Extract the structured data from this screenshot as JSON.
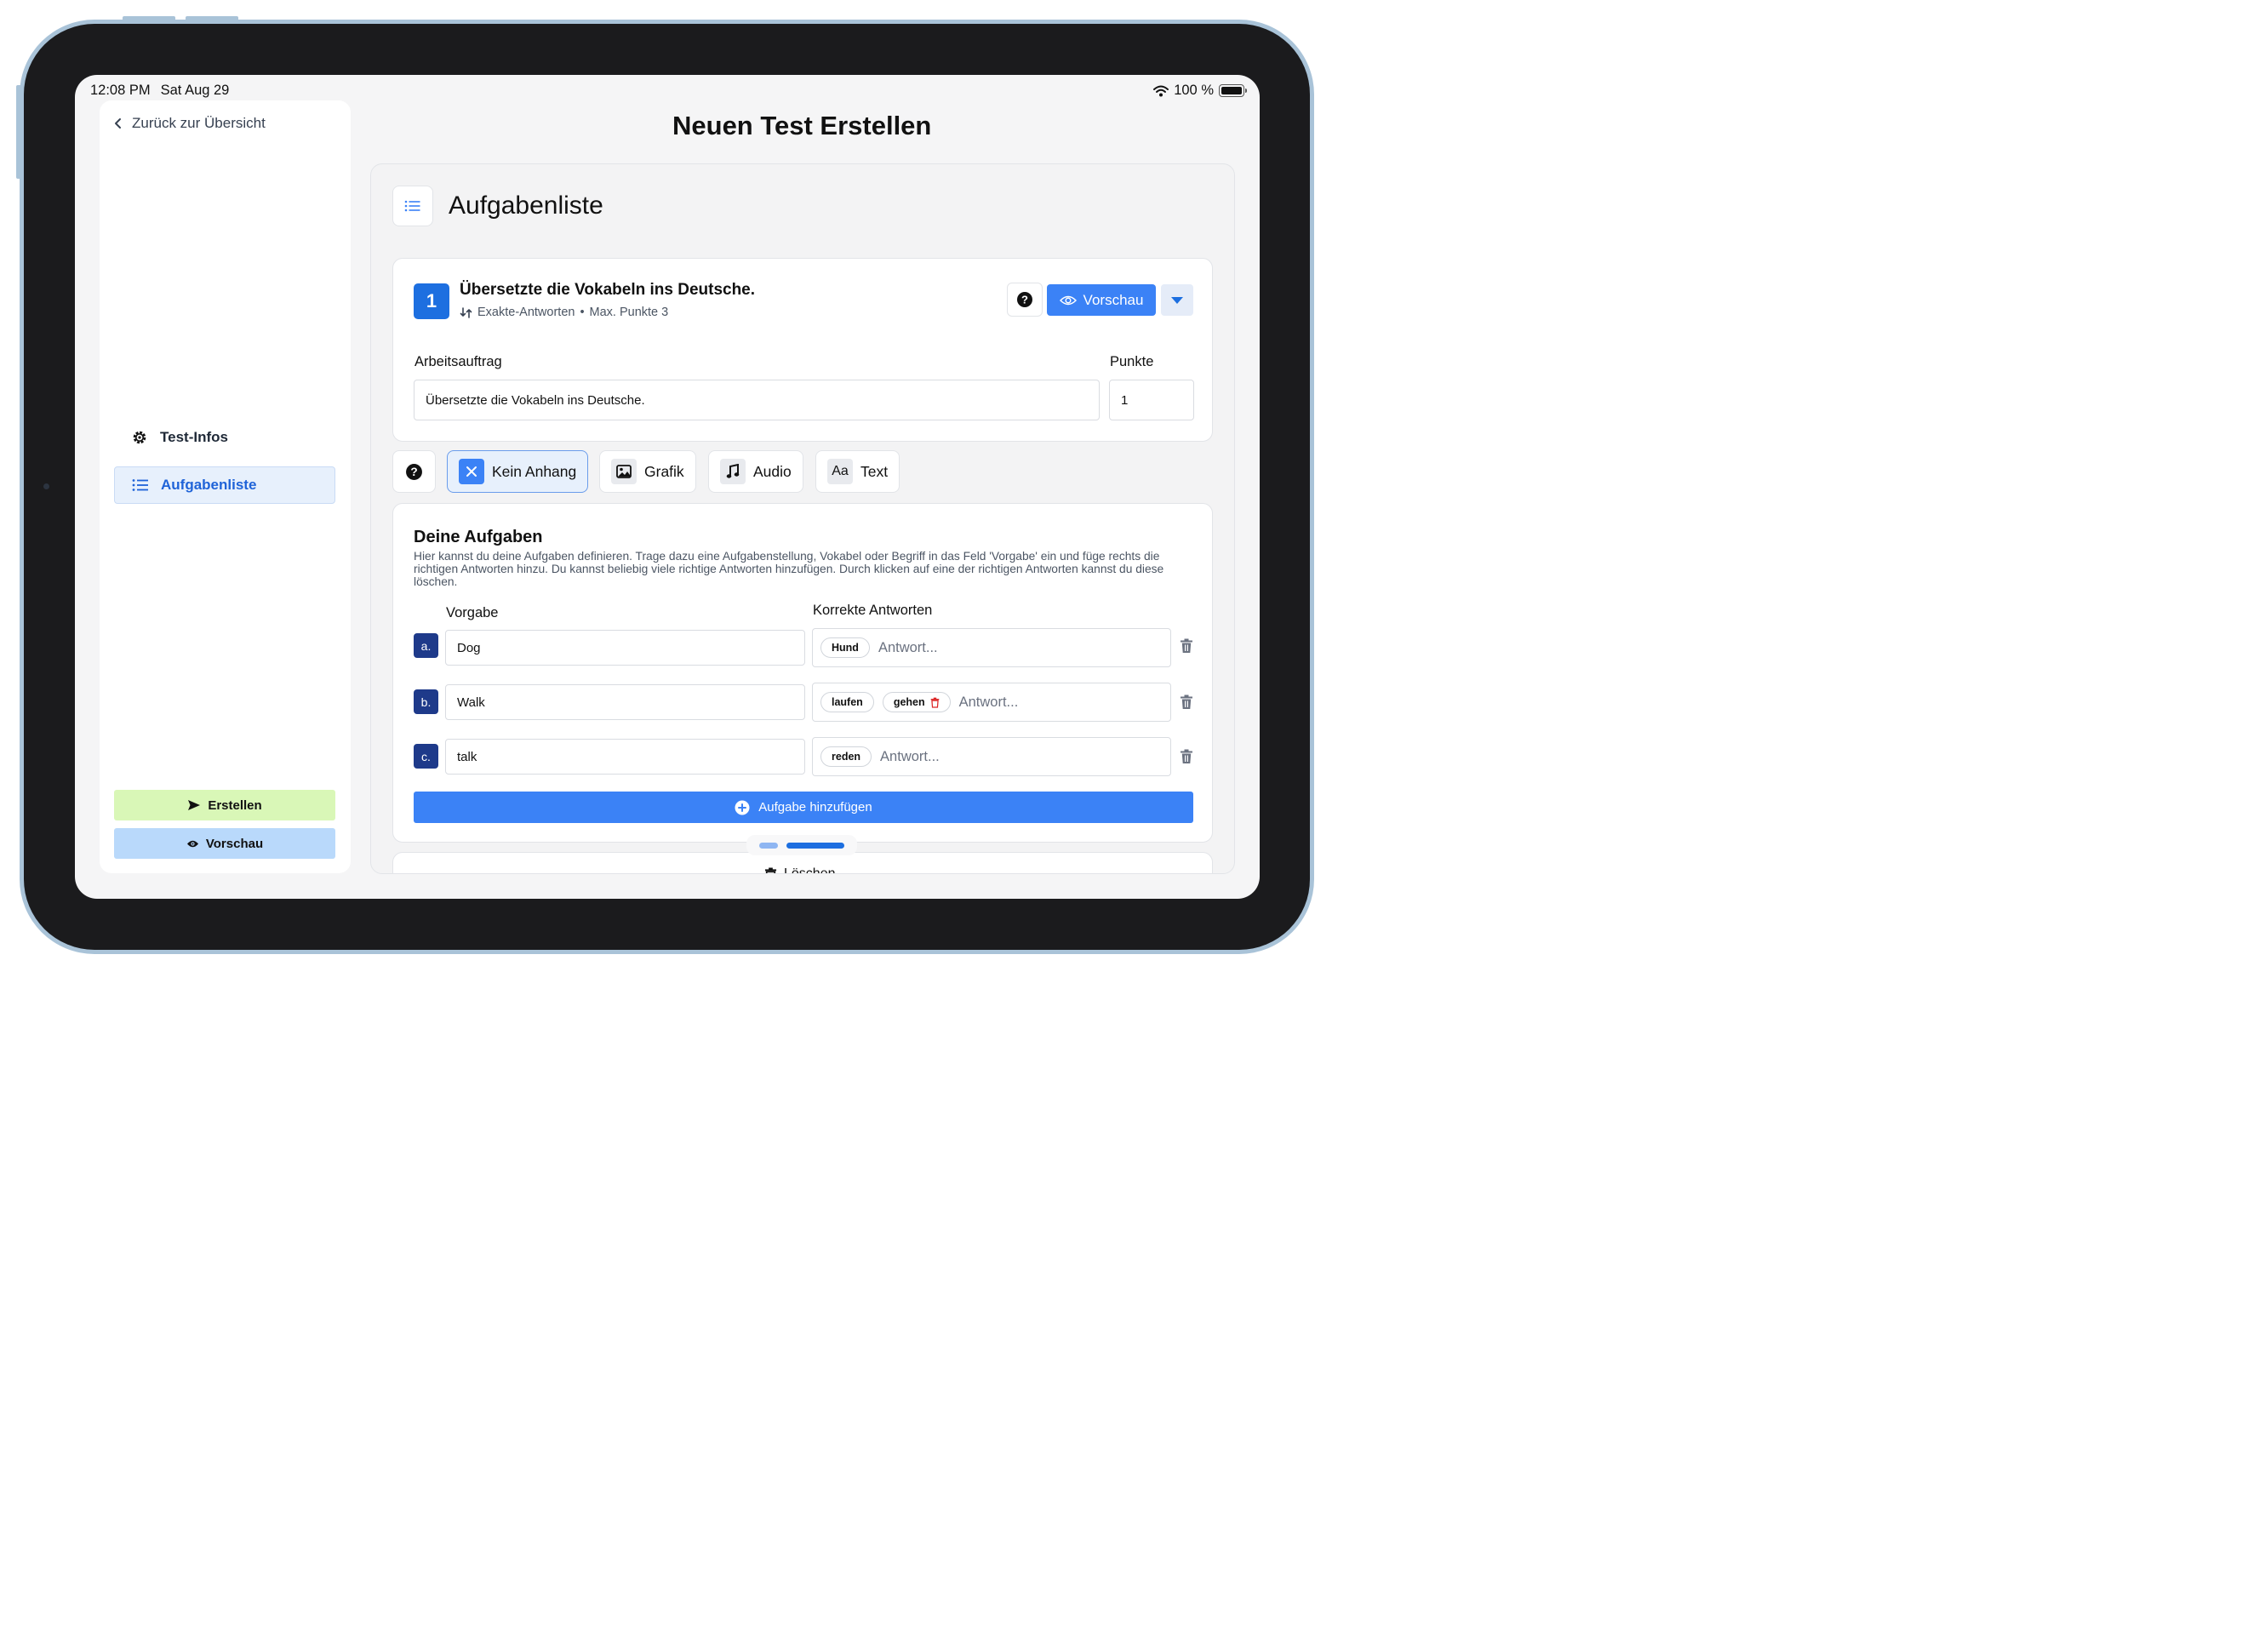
{
  "status_bar": {
    "time": "12:08 PM",
    "date": "Sat Aug 29",
    "battery": "100 %"
  },
  "sidebar": {
    "back_label": "Zurück zur Übersicht",
    "nav": [
      {
        "label": "Test-Infos",
        "icon": "gear-icon",
        "active": false
      },
      {
        "label": "Aufgabenliste",
        "icon": "list-icon",
        "active": true
      }
    ],
    "create_label": "Erstellen",
    "preview_label": "Vorschau",
    "colors": {
      "create_bg": "#d9f7b7",
      "preview_bg": "#b9d9fb"
    }
  },
  "page_title": "Neuen Test Erstellen",
  "main": {
    "section_title": "Aufgabenliste",
    "task": {
      "number": "1",
      "title": "Übersetzte die Vokabeln ins Deutsche.",
      "type": "Exakte-Antworten",
      "separator": "•",
      "max_points": "Max. Punkte 3",
      "preview_label": "Vorschau",
      "assignment_label": "Arbeitsauftrag",
      "assignment_value": "Übersetzte die Vokabeln ins Deutsche.",
      "points_label": "Punkte",
      "points_value": "1"
    },
    "attachments": [
      {
        "label": "Kein Anhang",
        "icon": "close-icon",
        "active": true
      },
      {
        "label": "Grafik",
        "icon": "image-icon",
        "active": false
      },
      {
        "label": "Audio",
        "icon": "music-note-icon",
        "active": false
      },
      {
        "label": "Text",
        "icon": "text-format-icon",
        "active": false
      }
    ],
    "aufgaben": {
      "heading": "Deine Aufgaben",
      "description": "Hier kannst du deine Aufgaben definieren. Trage dazu eine Aufgabenstellung, Vokabel oder Begriff in das Feld 'Vorgabe' ein und füge rechts die richtigen Antworten hinzu. Du kannst beliebig viele richtige Antworten hinzufügen. Durch klicken auf eine der richtigen Antworten kannst du diese löschen.",
      "col_vorgabe": "Vorgabe",
      "col_answers": "Korrekte Antworten",
      "answer_placeholder": "Antwort...",
      "rows": [
        {
          "letter": "a.",
          "vorgabe": "Dog",
          "answers": [
            "Hund"
          ]
        },
        {
          "letter": "b.",
          "vorgabe": "Walk",
          "answers": [
            "laufen",
            "gehen"
          ]
        },
        {
          "letter": "c.",
          "vorgabe": "talk",
          "answers": [
            "reden"
          ]
        }
      ],
      "add_label": "Aufgabe hinzufügen"
    },
    "delete_label": "Löschen"
  },
  "colors": {
    "accent": "#3b82f6",
    "badge_blue": "#1d6fe0",
    "letter_badge": "#1e3a8a",
    "danger": "#dc2626"
  }
}
